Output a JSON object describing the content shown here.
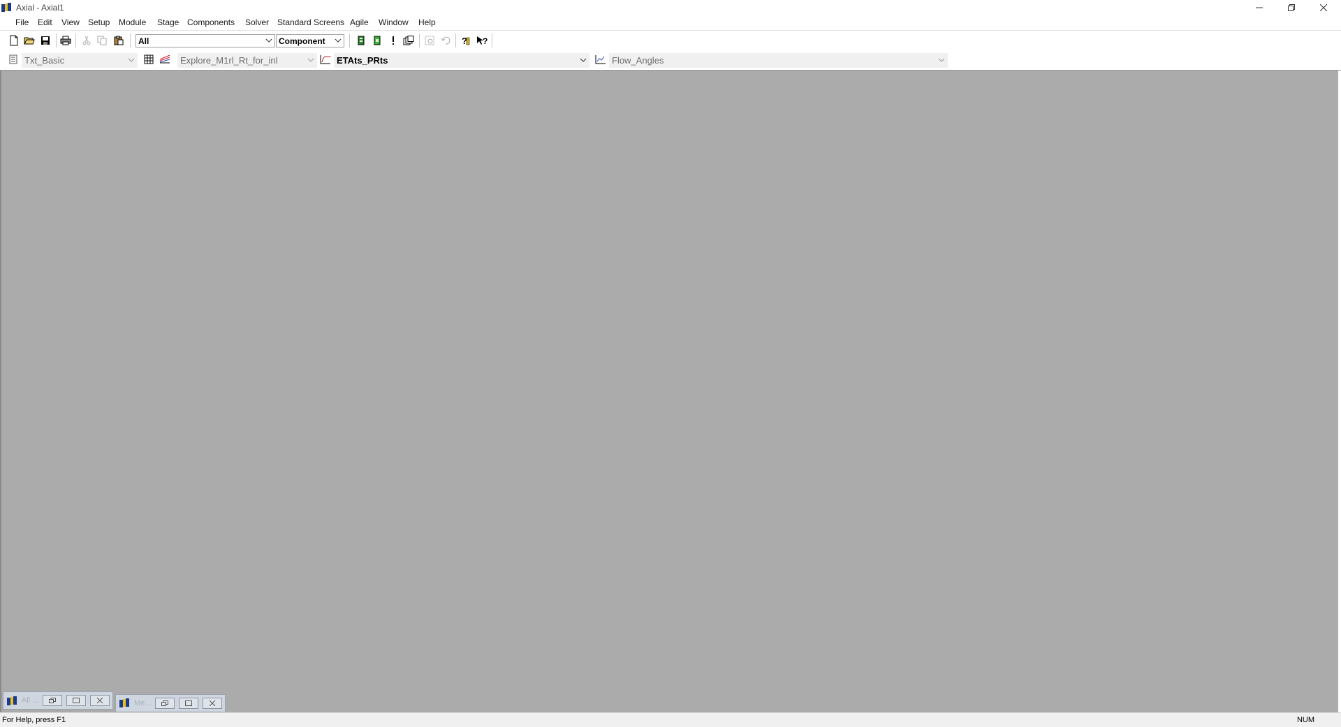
{
  "window": {
    "title": "Axial - Axial1",
    "min_icon": "minimize-icon",
    "max_icon": "restore-icon",
    "close_icon": "close-icon"
  },
  "menu": [
    "File",
    "Edit",
    "View",
    "Setup",
    "Module",
    "Stage",
    "Components",
    "Solver",
    "Standard Screens",
    "Agile",
    "Window",
    "Help"
  ],
  "toolbar1": {
    "filter_combo": "All",
    "type_combo": "Component"
  },
  "toolbar2": {
    "text_combo": "Txt_Basic",
    "explore_combo": "Explore_M1rl_Rt_for_inl",
    "plot_combo": "ETAts_PRts",
    "chart_combo": "Flow_Angles"
  },
  "minimized_windows": [
    {
      "label": "All ..."
    },
    {
      "label": "Me..."
    }
  ],
  "status": {
    "message": "For Help, press F1",
    "num": "NUM"
  },
  "colors": {
    "mdi_background": "#ababab",
    "accent": "#1a3a8a"
  }
}
